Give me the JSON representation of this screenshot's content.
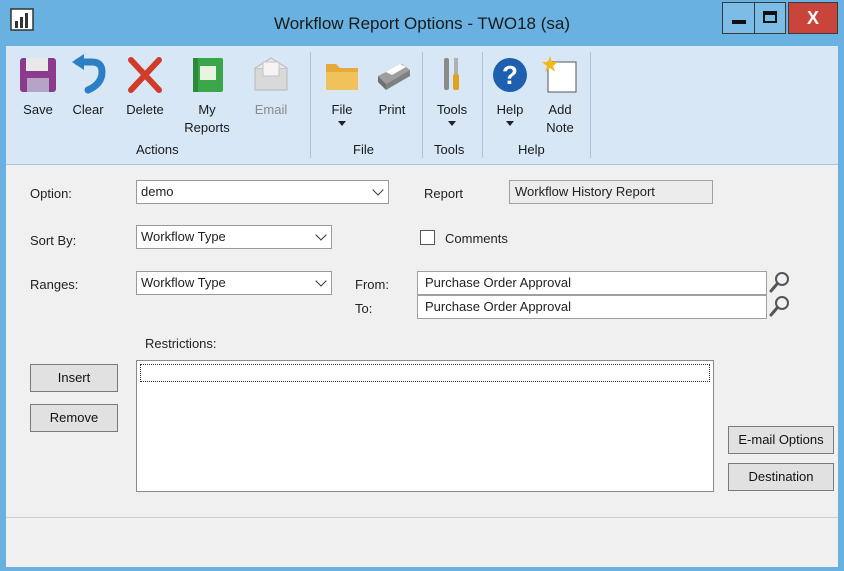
{
  "window": {
    "title": "Workflow Report Options  -  TWO18 (sa)",
    "close_label": "X",
    "accent": "#68b1e0"
  },
  "ribbon": {
    "actions": {
      "save": "Save",
      "clear": "Clear",
      "delete": "Delete",
      "my_reports": "My Reports",
      "email": "Email",
      "group": "Actions"
    },
    "file": {
      "file": "File",
      "print": "Print",
      "group": "File"
    },
    "tools": {
      "tools": "Tools",
      "group": "Tools"
    },
    "help": {
      "help": "Help",
      "add_note": "Add Note",
      "group": "Help"
    }
  },
  "form": {
    "option_label": "Option:",
    "option_value": "demo",
    "report_label": "Report",
    "report_value": "Workflow History Report",
    "sort_label": "Sort By:",
    "sort_value": "Workflow Type",
    "comments_label": "Comments",
    "comments_checked": false,
    "ranges_label": "Ranges:",
    "ranges_value": "Workflow Type",
    "from_label": "From:",
    "from_value": "Purchase Order Approval",
    "to_label": "To:",
    "to_value": "Purchase Order Approval",
    "restrictions_label": "Restrictions:",
    "insert_button": "Insert",
    "remove_button": "Remove",
    "email_options_button": "E-mail Options",
    "destination_button": "Destination"
  }
}
